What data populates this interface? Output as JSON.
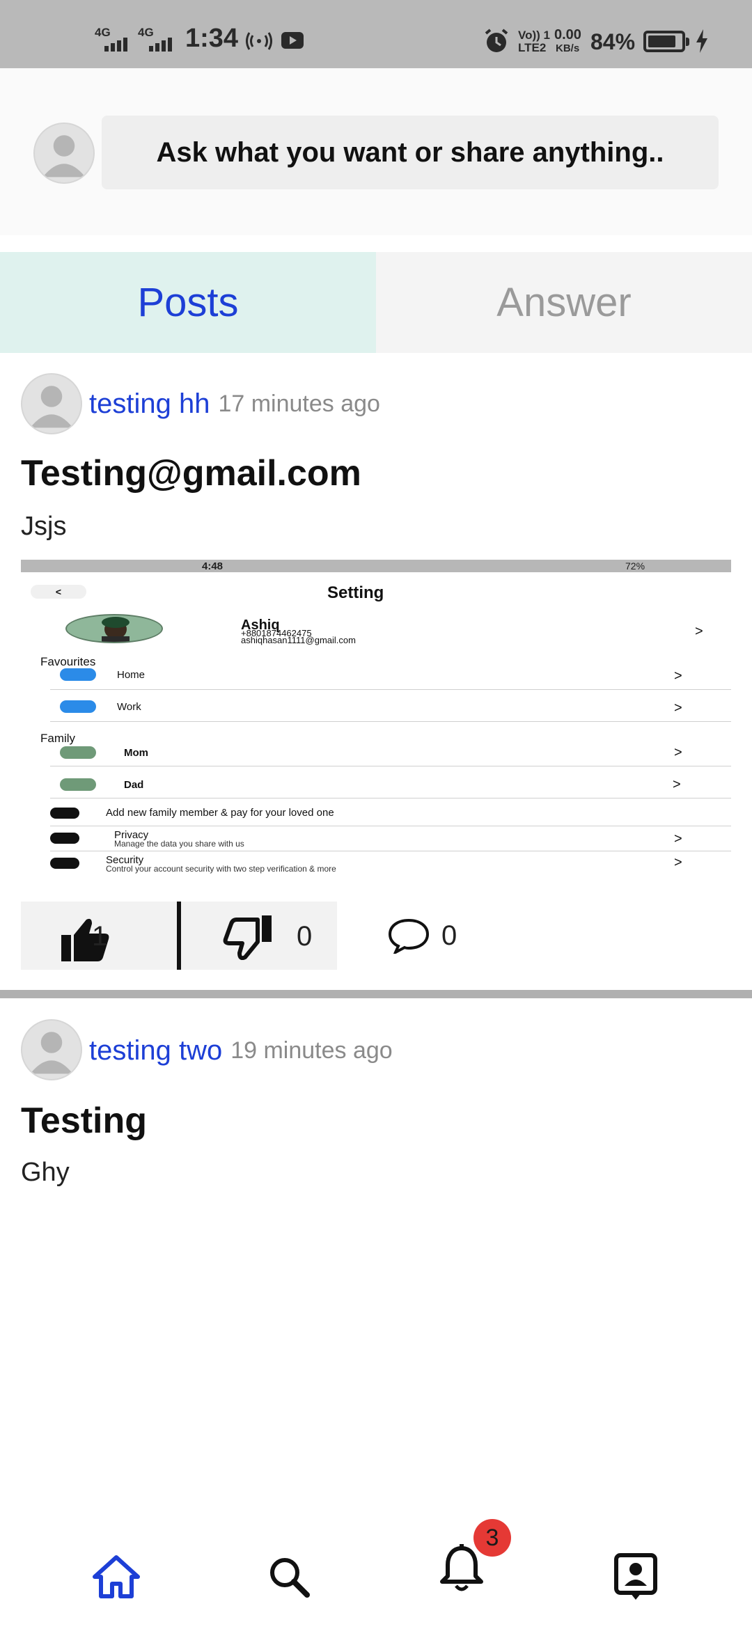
{
  "status_bar": {
    "net1": "4G",
    "net2": "4G",
    "time": "1:34",
    "volte": "Vo)) 1",
    "lte": "LTE2",
    "speed_value": "0.00",
    "speed_unit": "KB/s",
    "battery": "84%",
    "battery_level": 0.84
  },
  "ask": {
    "placeholder": "Ask what you want or share anything.."
  },
  "tabs": [
    {
      "label": "Posts",
      "active": true
    },
    {
      "label": "Answer",
      "active": false
    }
  ],
  "posts": [
    {
      "author": "testing hh",
      "time": "17 minutes ago",
      "title": "Testing@gmail.com",
      "body": "Jsjs",
      "likes": "1",
      "dislikes": "0",
      "comments": "0",
      "image": {
        "status_time": "4:48",
        "status_battery": "72%",
        "header_title": "Setting",
        "profile_name": "Ashiq",
        "profile_phone": "+8801874462475",
        "profile_email": "ashiqhasan1111@gmail.com",
        "section_favourites": "Favourites",
        "item_home": "Home",
        "item_work": "Work",
        "section_family": "Family",
        "item_mom": "Mom",
        "item_dad": "Dad",
        "item_add": "Add new family member & pay for your loved one",
        "item_privacy": "Privacy",
        "item_privacy_sub": "Manage the data you share with us",
        "item_security": "Security",
        "item_security_sub": "Control your account security with two step verification & more",
        "arrow": ">"
      }
    },
    {
      "author": "testing two",
      "time": "19 minutes ago",
      "title": "Testing",
      "body": "Ghy"
    }
  ],
  "bottom_nav": {
    "items": [
      "home-icon",
      "search-icon",
      "bell-icon",
      "profile-icon"
    ],
    "notification_count": "3",
    "active_color": "#1d3fd6",
    "badge_color": "#e53935"
  }
}
